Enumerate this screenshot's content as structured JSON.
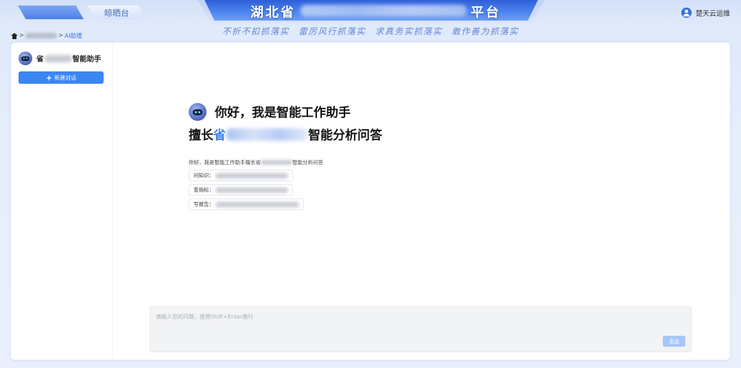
{
  "header": {
    "nav_tabs": [
      {
        "label": ""
      },
      {
        "label": "晾晒台"
      }
    ],
    "title_left": "湖北省",
    "title_right": "平台",
    "slogan": "不折不扣抓落实  雷厉风行抓落实  求真务实抓落实  敢作善为抓落实",
    "user_name": "楚天云运维"
  },
  "breadcrumb": {
    "separator": ">",
    "current": "AI助理"
  },
  "sidebar": {
    "assistant_name_prefix": "省",
    "assistant_name_suffix": "智能助手",
    "new_chat_label": "新建对话",
    "plus_glyph": "+"
  },
  "welcome": {
    "greeting": "你好，我是智能工作助手",
    "good_at_prefix": "擅长",
    "good_at_accent": "省",
    "good_at_suffix": "智能分析问答",
    "intro_prefix": "你好，我是智能工作助手擅长省",
    "intro_suffix": "智能分析问答",
    "prompts": [
      {
        "label": "问知识："
      },
      {
        "label": "查指标："
      },
      {
        "label": "写报告："
      }
    ]
  },
  "input": {
    "placeholder": "请输入您的问题，使用Shift+Enter换行",
    "send_label": "发送"
  },
  "colors": {
    "accent": "#3c86f2",
    "title_bar": "#3f74e6",
    "send_disabled": "#a6c6f8"
  }
}
